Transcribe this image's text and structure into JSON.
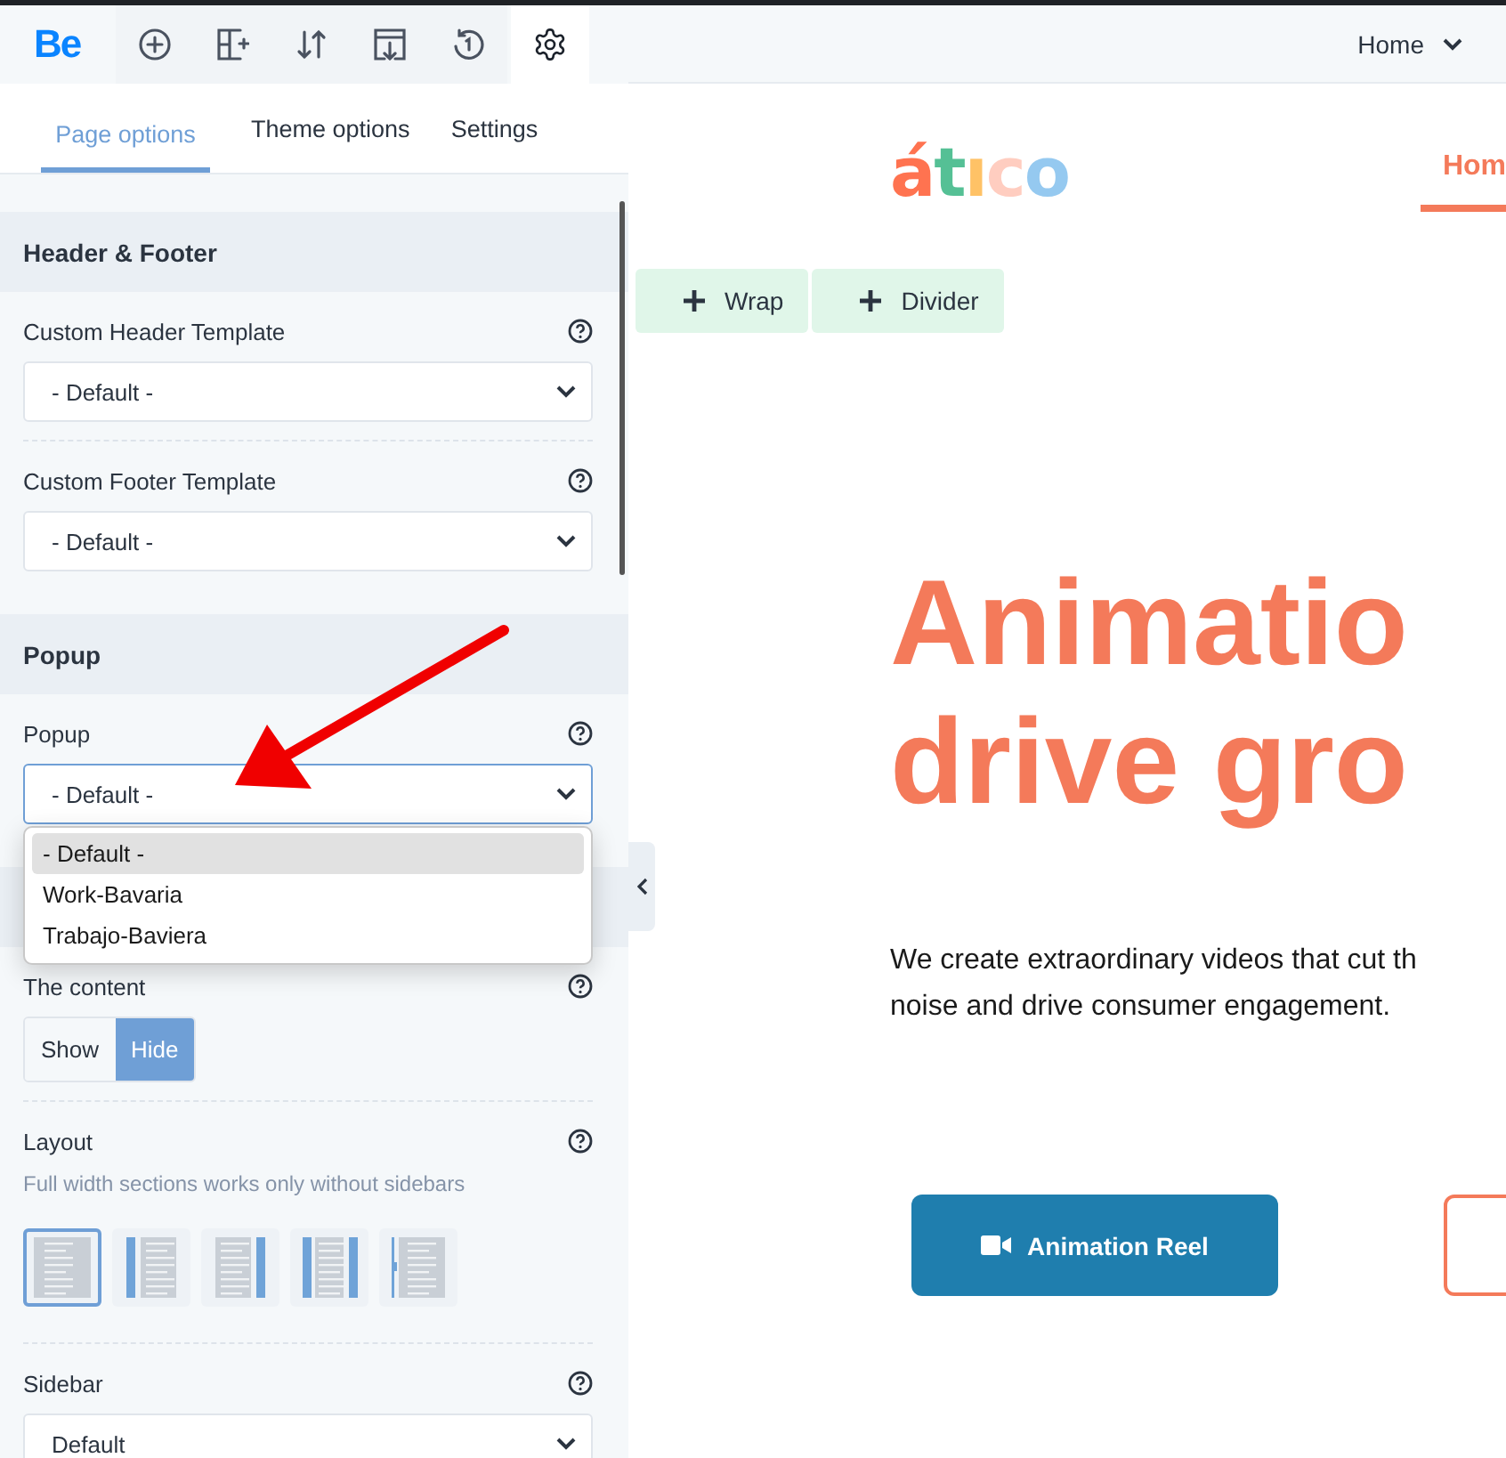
{
  "toolbar": {
    "logo": "Be",
    "tools": [
      {
        "kind": "add",
        "selected": false
      },
      {
        "kind": "layout",
        "selected": false
      },
      {
        "kind": "sort",
        "selected": false
      },
      {
        "kind": "export",
        "selected": false
      },
      {
        "kind": "history",
        "selected": false
      },
      {
        "kind": "settings",
        "selected": true
      }
    ]
  },
  "tabs": [
    {
      "label": "Page options",
      "selected": true
    },
    {
      "label": "Theme options",
      "selected": false
    },
    {
      "label": "Settings",
      "selected": false
    }
  ],
  "sections": [
    {
      "title": "Header & Footer",
      "fields": [
        {
          "kind": "select",
          "label": "Custom Header Template",
          "value": "- Default -",
          "focused": false
        },
        {
          "kind": "select",
          "label": "Custom Footer Template",
          "value": "- Default -",
          "focused": false
        }
      ]
    },
    {
      "title": "Popup",
      "fields": [
        {
          "kind": "select",
          "label": "Popup",
          "value": "- Default -",
          "focused": true,
          "expanded": true,
          "options": [
            {
              "label": "- Default -",
              "selected": true
            },
            {
              "label": "Work-Bavaria",
              "selected": false
            },
            {
              "label": "Trabajo-Baviera",
              "selected": false
            }
          ]
        }
      ]
    },
    {
      "fields": [
        {
          "kind": "toggle",
          "label": "The content",
          "options": [
            {
              "label": "Show",
              "selected": false
            },
            {
              "label": "Hide",
              "selected": true
            }
          ]
        },
        {
          "kind": "layout",
          "label": "Layout",
          "hint": "Full width sections works only without sidebars",
          "options": [
            {
              "kind": "full",
              "selected": true
            },
            {
              "kind": "left",
              "selected": false
            },
            {
              "kind": "right",
              "selected": false
            },
            {
              "kind": "both",
              "selected": false
            },
            {
              "kind": "offcanvas",
              "selected": false
            }
          ]
        },
        {
          "kind": "select",
          "label": "Sidebar",
          "value": "Default",
          "focused": false
        }
      ]
    }
  ],
  "page": {
    "topbar": {
      "menu": "Home"
    },
    "logo": {
      "letters": [
        {
          "text": "á",
          "color": "#ff7350"
        },
        {
          "text": "t",
          "color": "#55c095"
        },
        {
          "text": "ı",
          "color": "#ffc266"
        },
        {
          "text": "c",
          "color": "#ffcdc0"
        },
        {
          "text": "o",
          "color": "#95c9f0"
        }
      ]
    },
    "nav": [
      {
        "label": "Hom",
        "selected": true
      }
    ],
    "add_buttons": [
      "Wrap",
      "Divider"
    ],
    "heading": [
      "Animatio",
      "drive gro"
    ],
    "intro": [
      "We create extraordinary videos that cut th",
      "noise and drive consumer engagement."
    ],
    "cta": [
      {
        "kind": "filled",
        "label": "Animation Reel"
      },
      {
        "kind": "outline"
      }
    ]
  },
  "annotation": {
    "kind": "arrow"
  }
}
